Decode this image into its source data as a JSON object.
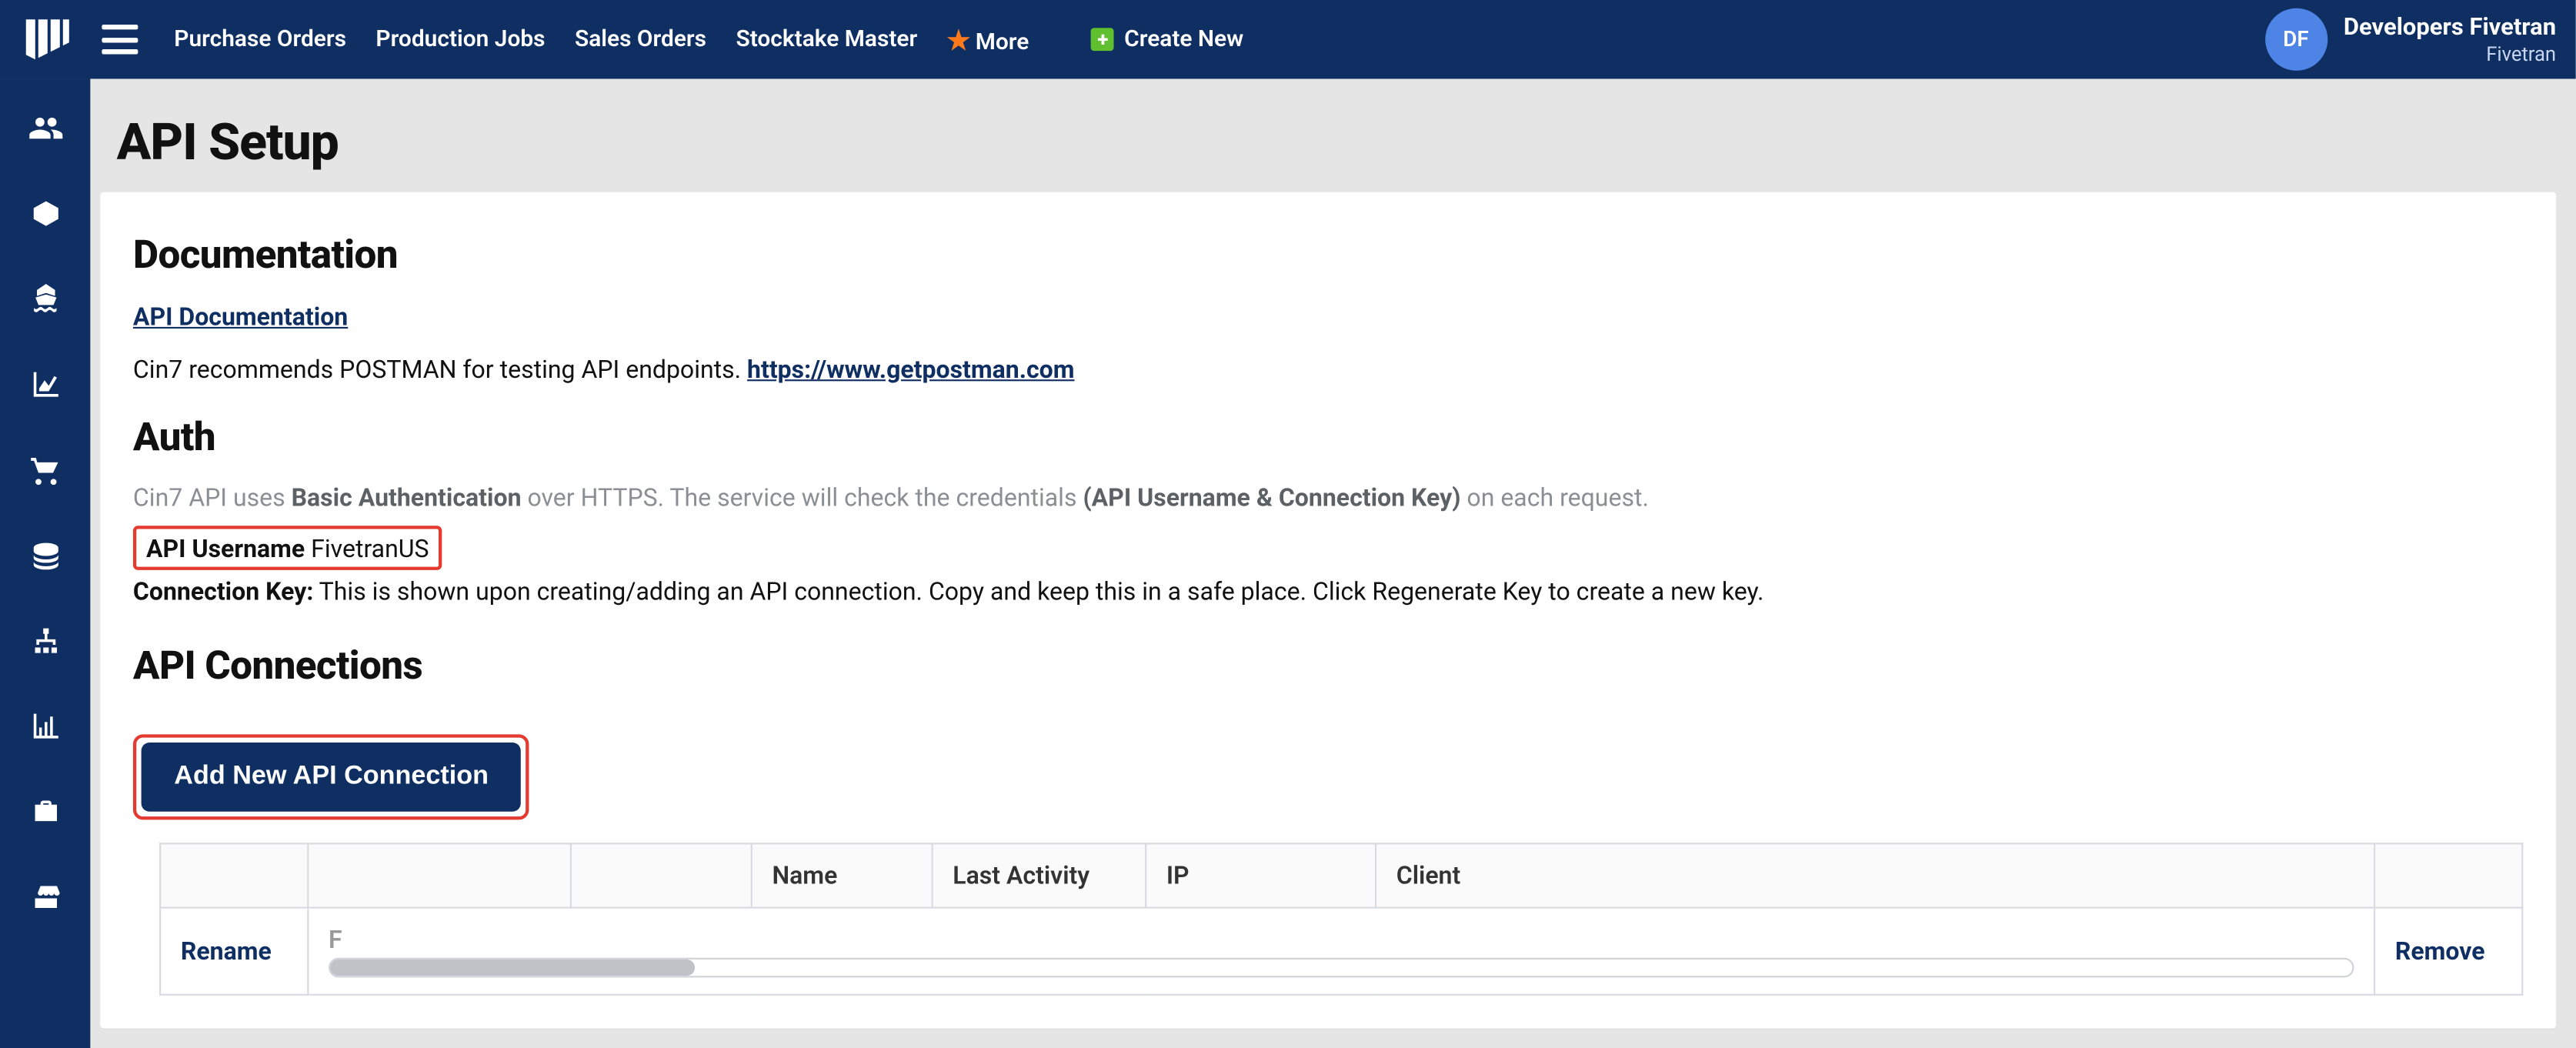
{
  "topbar": {
    "nav": {
      "purchase_orders": "Purchase Orders",
      "production_jobs": "Production Jobs",
      "sales_orders": "Sales Orders",
      "stocktake_master": "Stocktake Master",
      "more": "More",
      "create_new": "Create New"
    },
    "user": {
      "initials": "DF",
      "name": "Developers Fivetran",
      "sub": "Fivetran"
    }
  },
  "page": {
    "title": "API Setup"
  },
  "doc": {
    "heading": "Documentation",
    "api_doc_link": "API Documentation",
    "postman_pre": "Cin7 recommends POSTMAN for testing API endpoints. ",
    "postman_url_text": "https://www.getpostman.com"
  },
  "auth": {
    "heading": "Auth",
    "line1_pre": "Cin7 API uses ",
    "line1_bold1": "Basic Authentication",
    "line1_mid": " over HTTPS. The service will check the credentials ",
    "line1_bold2": "(API Username & Connection Key)",
    "line1_post": " on each request.",
    "api_username_label": "API Username",
    "api_username_value": "FivetranUS",
    "conn_key_label": "Connection Key:",
    "conn_key_text": " This is shown upon creating/adding an API connection. Copy and keep this in a safe place. Click Regenerate Key to create a new key."
  },
  "api_conn": {
    "heading": "API Connections",
    "add_btn": "Add New API Connection",
    "cols": {
      "c1": "",
      "c2": "",
      "c3": "",
      "name": "Name",
      "last_activity": "Last Activity",
      "ip": "IP",
      "client": "Client",
      "c8": ""
    },
    "row": {
      "rename": "Rename",
      "remove": "Remove",
      "hint": "F"
    }
  },
  "sidebar_icons": [
    "users",
    "box",
    "boat",
    "chart-area",
    "cart",
    "coins",
    "sitemap",
    "bar-chart",
    "briefcase",
    "store"
  ]
}
